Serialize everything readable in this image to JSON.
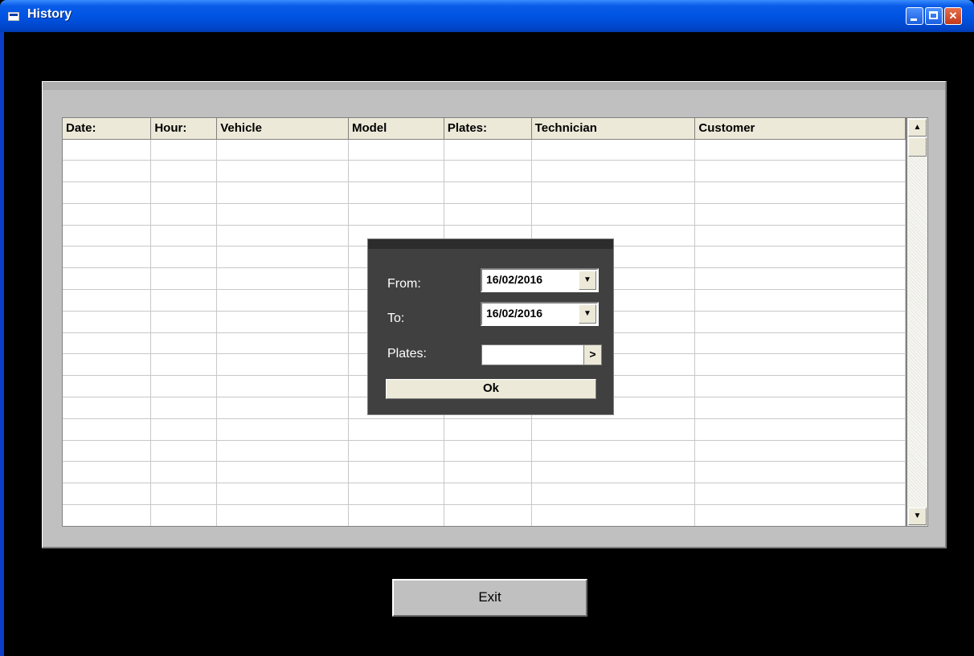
{
  "window": {
    "title": "History"
  },
  "grid": {
    "columns": [
      "Date:",
      "Hour:",
      "Vehicle",
      "Model",
      "Plates:",
      "Technician",
      "Customer"
    ],
    "empty_row_count": 19
  },
  "dialog": {
    "from_label": "From:",
    "from_value": "16/02/2016",
    "to_label": "To:",
    "to_value": "16/02/2016",
    "plates_label": "Plates:",
    "plates_value": "",
    "go_symbol": ">",
    "ok_label": "Ok"
  },
  "exit_label": "Exit"
}
